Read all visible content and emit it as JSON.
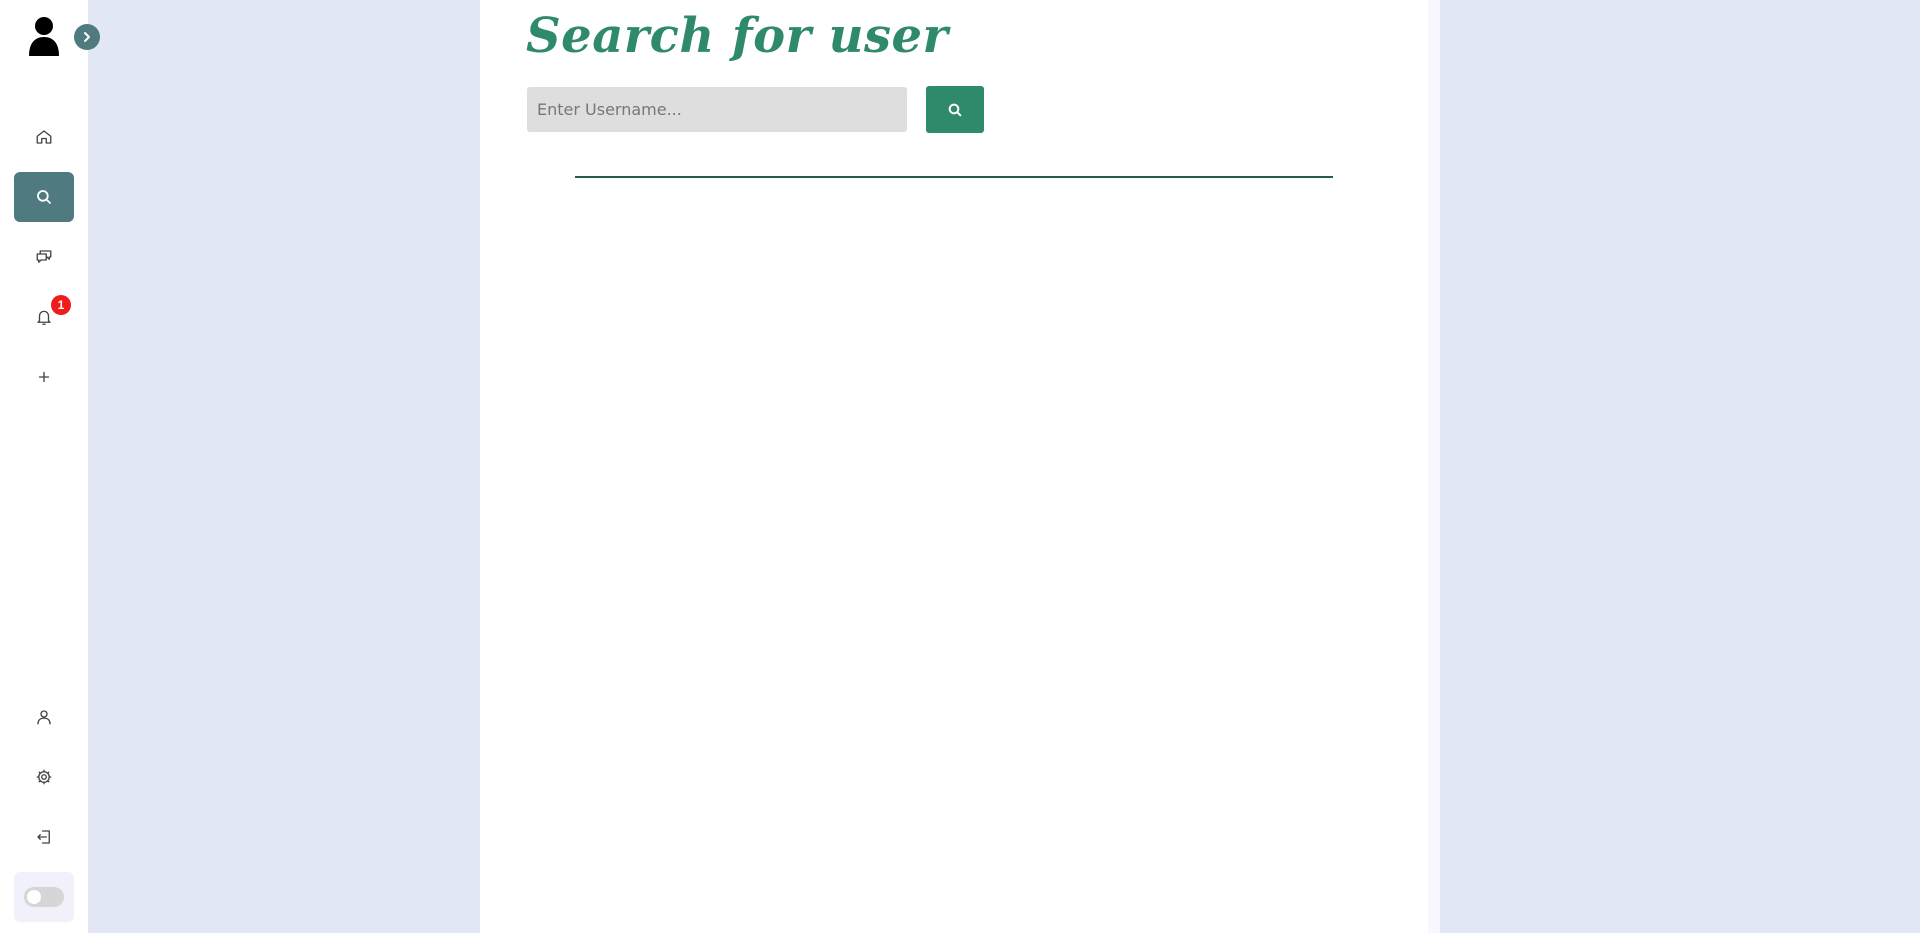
{
  "title": "Search for user",
  "search": {
    "placeholder": "Enter Username...",
    "value": "",
    "button_icon": "search-icon"
  },
  "sidebar": {
    "avatar_icon": "user-silhouette-icon",
    "expand_icon": "chevron-right-icon",
    "nav": [
      {
        "icon": "home-icon",
        "active": false
      },
      {
        "icon": "search-icon",
        "active": true
      },
      {
        "icon": "chat-icon",
        "active": false
      },
      {
        "icon": "bell-icon",
        "active": false,
        "badge": "1"
      },
      {
        "icon": "plus-icon",
        "active": false
      }
    ],
    "bottom": [
      {
        "icon": "user-icon"
      },
      {
        "icon": "gear-icon"
      },
      {
        "icon": "logout-icon"
      }
    ],
    "theme_toggle_on": false
  },
  "colors": {
    "background": "#e1e7f5",
    "accent": "#2e8a6a",
    "sidebar_active": "#4f7b80",
    "badge": "#ee1c1c",
    "divider": "#1f5e4c"
  }
}
